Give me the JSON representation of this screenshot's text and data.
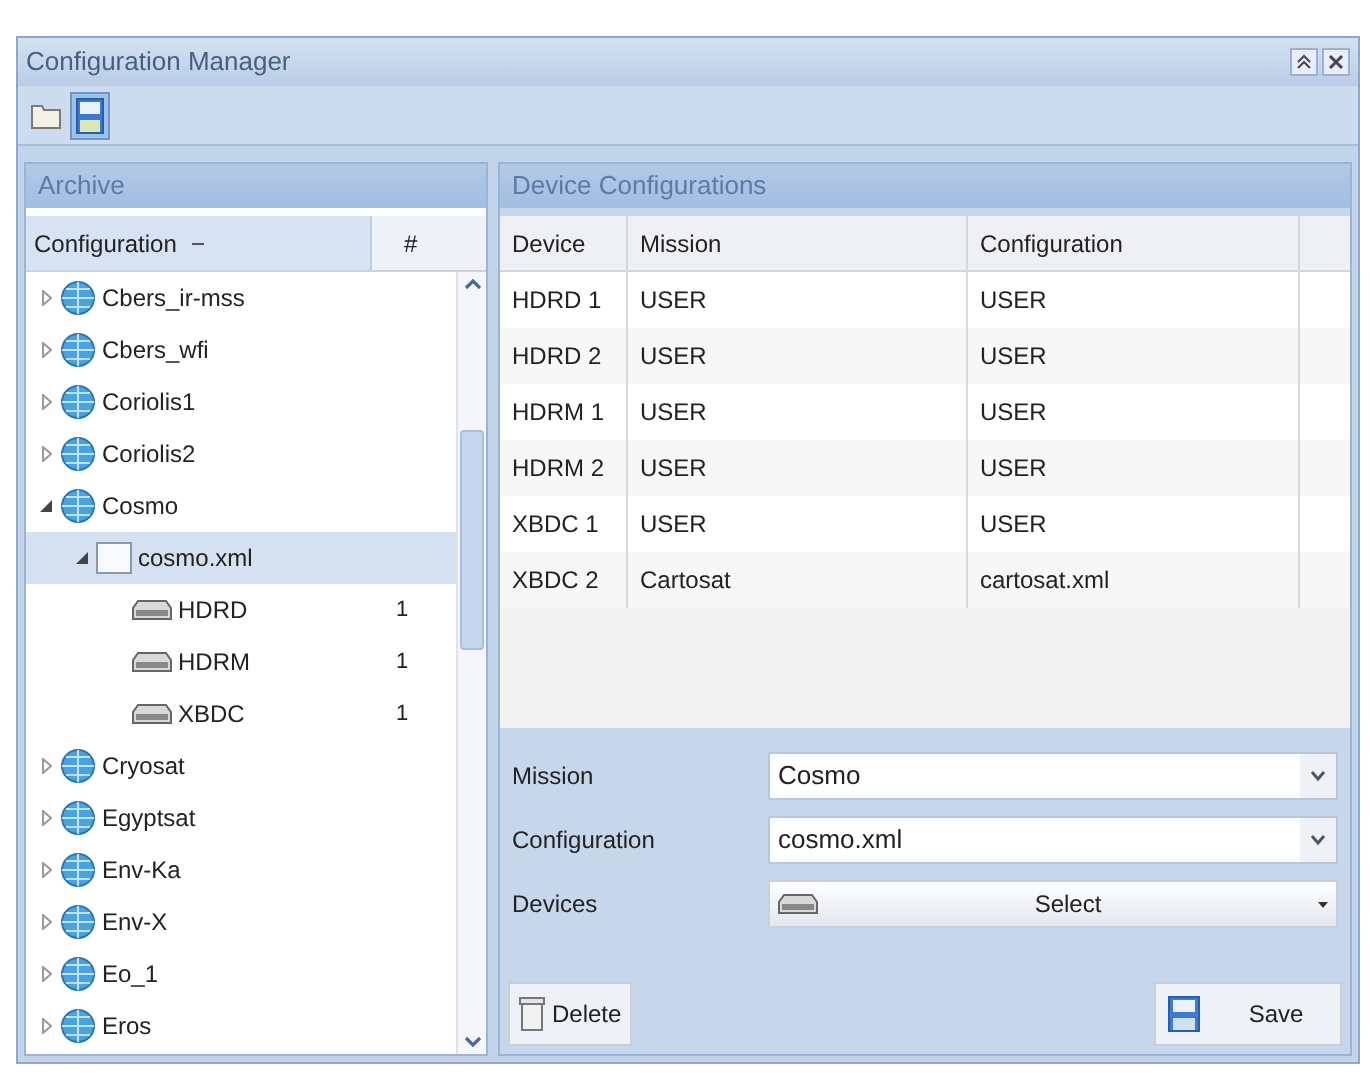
{
  "window": {
    "title": "Configuration Manager"
  },
  "archive": {
    "title": "Archive",
    "columns": [
      {
        "label": "Configuration",
        "sorted": true
      },
      {
        "label": "#"
      }
    ],
    "tree": [
      {
        "label": "Cbers_ir-mss",
        "kind": "mission",
        "expanded": false,
        "selected": false
      },
      {
        "label": "Cbers_wfi",
        "kind": "mission",
        "expanded": false,
        "selected": false
      },
      {
        "label": "Coriolis1",
        "kind": "mission",
        "expanded": false,
        "selected": false
      },
      {
        "label": "Coriolis2",
        "kind": "mission",
        "expanded": false,
        "selected": false
      },
      {
        "label": "Cosmo",
        "kind": "mission",
        "expanded": true,
        "selected": false,
        "children": [
          {
            "label": "cosmo.xml",
            "kind": "file",
            "expanded": true,
            "selected": true,
            "children": [
              {
                "label": "HDRD",
                "kind": "device",
                "count": "1",
                "selected": false
              },
              {
                "label": "HDRM",
                "kind": "device",
                "count": "1",
                "selected": false
              },
              {
                "label": "XBDC",
                "kind": "device",
                "count": "1",
                "selected": false
              }
            ]
          }
        ]
      },
      {
        "label": "Cryosat",
        "kind": "mission",
        "expanded": false,
        "selected": false
      },
      {
        "label": "Egyptsat",
        "kind": "mission",
        "expanded": false,
        "selected": false
      },
      {
        "label": "Env-Ka",
        "kind": "mission",
        "expanded": false,
        "selected": false
      },
      {
        "label": "Env-X",
        "kind": "mission",
        "expanded": false,
        "selected": false
      },
      {
        "label": "Eo_1",
        "kind": "mission",
        "expanded": false,
        "selected": false
      },
      {
        "label": "Eros",
        "kind": "mission",
        "expanded": false,
        "selected": false
      }
    ]
  },
  "device_configurations": {
    "title": "Device Configurations",
    "columns": [
      "Device",
      "Mission",
      "Configuration"
    ],
    "rows": [
      [
        "HDRD 1",
        "USER",
        "USER"
      ],
      [
        "HDRD 2",
        "USER",
        "USER"
      ],
      [
        "HDRM 1",
        "USER",
        "USER"
      ],
      [
        "HDRM 2",
        "USER",
        "USER"
      ],
      [
        "XBDC 1",
        "USER",
        "USER"
      ],
      [
        "XBDC 2",
        "Cartosat",
        "cartosat.xml"
      ]
    ],
    "form": [
      {
        "label": "Mission",
        "kind": "combo",
        "value": "Cosmo"
      },
      {
        "label": "Configuration",
        "kind": "combo",
        "value": "cosmo.xml"
      },
      {
        "label": "Devices",
        "kind": "menu",
        "value": "Select"
      }
    ],
    "buttons": [
      {
        "label": "Delete",
        "kind": "delete"
      },
      {
        "label": "Save",
        "kind": "save"
      }
    ]
  }
}
